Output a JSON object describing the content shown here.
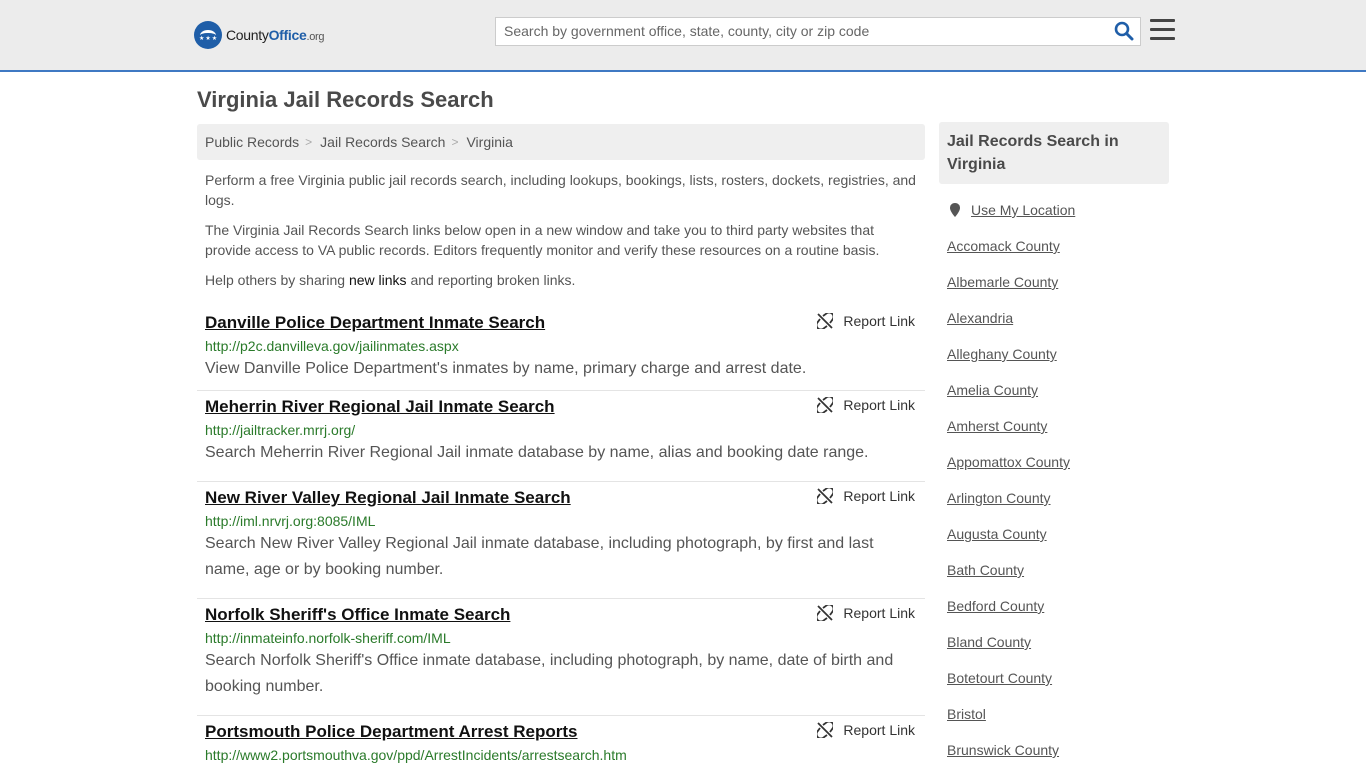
{
  "header": {
    "logo": {
      "brand_a": "County",
      "brand_b": "Office",
      "brand_c": ".org"
    },
    "search_placeholder": "Search by government office, state, county, city or zip code"
  },
  "page_title": "Virginia Jail Records Search",
  "breadcrumb": [
    "Public Records",
    "Jail Records Search",
    "Virginia"
  ],
  "intro": {
    "p1": "Perform a free Virginia public jail records search, including lookups, bookings, lists, rosters, dockets, registries, and logs.",
    "p2": "The Virginia Jail Records Search links below open in a new window and take you to third party websites that provide access to VA public records. Editors frequently monitor and verify these resources on a routine basis.",
    "p3_before": "Help others by sharing ",
    "p3_link": "new links",
    "p3_after": " and reporting broken links."
  },
  "report_label": "Report Link",
  "results": [
    {
      "title": "Danville Police Department Inmate Search",
      "url": "http://p2c.danvilleva.gov/jailinmates.aspx",
      "desc": "View Danville Police Department's inmates by name, primary charge and arrest date."
    },
    {
      "title": "Meherrin River Regional Jail Inmate Search",
      "url": "http://jailtracker.mrrj.org/",
      "desc": "Search Meherrin River Regional Jail inmate database by name, alias and booking date range."
    },
    {
      "title": "New River Valley Regional Jail Inmate Search",
      "url": "http://iml.nrvrj.org:8085/IML",
      "desc": "Search New River Valley Regional Jail inmate database, including photograph, by first and last name, age or by booking number."
    },
    {
      "title": "Norfolk Sheriff's Office Inmate Search",
      "url": "http://inmateinfo.norfolk-sheriff.com/IML",
      "desc": "Search Norfolk Sheriff's Office inmate database, including photograph, by name, date of birth and booking number."
    },
    {
      "title": "Portsmouth Police Department Arrest Reports",
      "url": "http://www2.portsmouthva.gov/ppd/ArrestIncidents/arrestsearch.htm",
      "desc": ""
    }
  ],
  "sidebar": {
    "heading": "Jail Records Search in Virginia",
    "use_location": "Use My Location",
    "links": [
      "Accomack County",
      "Albemarle County",
      "Alexandria",
      "Alleghany County",
      "Amelia County",
      "Amherst County",
      "Appomattox County",
      "Arlington County",
      "Augusta County",
      "Bath County",
      "Bedford County",
      "Bland County",
      "Botetourt County",
      "Bristol",
      "Brunswick County"
    ]
  }
}
